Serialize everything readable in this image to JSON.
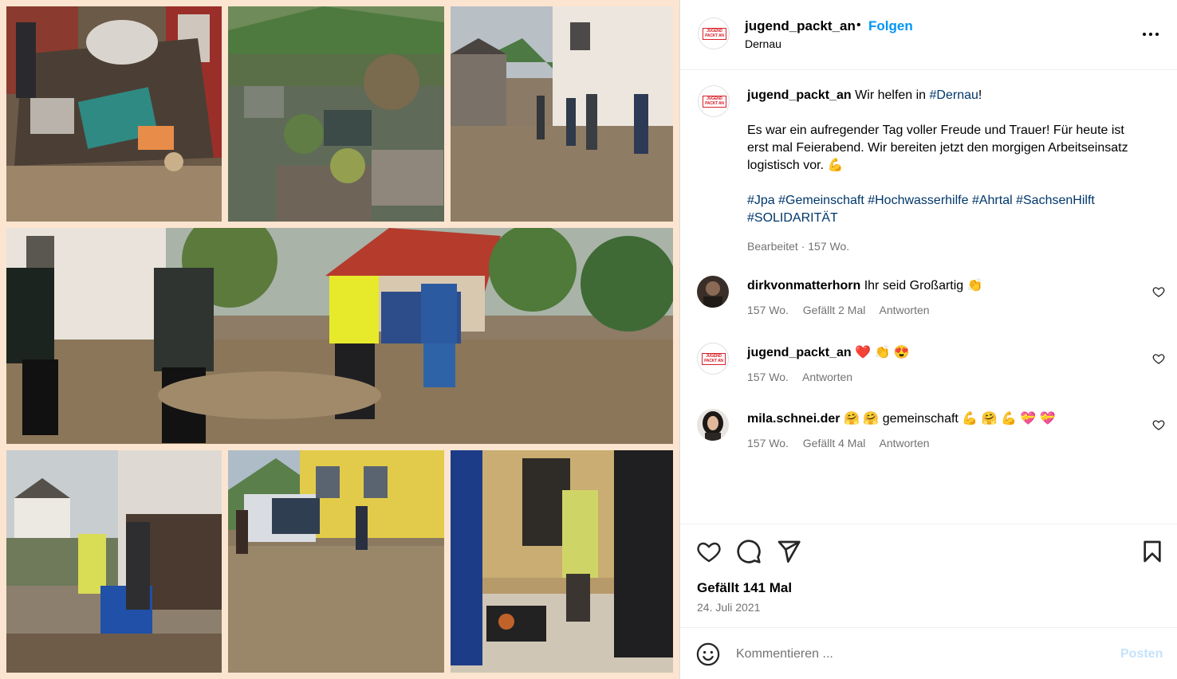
{
  "header": {
    "username": "jugend_packt_an",
    "separator": "•",
    "follow_label": "Folgen",
    "location": "Dernau",
    "avatar_logo_text": [
      "JUGEND",
      "PACKT AN"
    ]
  },
  "caption": {
    "username": "jugend_packt_an",
    "line1_prefix": "Wir helfen in",
    "line1_tag": "#Dernau",
    "line1_suffix": "!",
    "paragraph": "Es war ein aufregender Tag voller Freude und Trauer! Für heute ist erst mal Feierabend. Wir bereiten jetzt den morgigen Arbeitseinsatz logistisch vor. 💪",
    "hashtags": [
      "#Jpa",
      "#Gemeinschaft",
      "#Hochwasserhilfe",
      "#Ahrtal",
      "#SachsenHilft",
      "#SOLIDARITÄT"
    ],
    "meta": "Bearbeitet · 157 Wo."
  },
  "comments": [
    {
      "username": "dirkvonmatterhorn",
      "text": "Ihr seid Großartig 👏",
      "time": "157 Wo.",
      "likes": "Gefällt 2 Mal",
      "reply": "Antworten"
    },
    {
      "username": "jugend_packt_an",
      "text": "❤️ 👏 😍",
      "time": "157 Wo.",
      "likes": "",
      "reply": "Antworten"
    },
    {
      "username": "mila.schnei.der",
      "text": "🤗 🤗  gemeinschaft 💪 🤗 💪  💝 💝",
      "time": "157 Wo.",
      "likes": "Gefällt 4 Mal",
      "reply": "Antworten"
    }
  ],
  "actions": {
    "likes": "Gefällt 141 Mal",
    "date": "24. Juli 2021"
  },
  "comment_box": {
    "placeholder": "Kommentieren ...",
    "post_label": "Posten"
  },
  "colors": {
    "link": "#0095f6",
    "hashtag": "#00376b",
    "muted": "#737373",
    "collage_border": "#fbe5d0",
    "logo_red": "#d8202a"
  },
  "icons": [
    "more-icon",
    "heart-icon",
    "comment-icon",
    "share-icon",
    "bookmark-icon",
    "emoji-icon"
  ]
}
